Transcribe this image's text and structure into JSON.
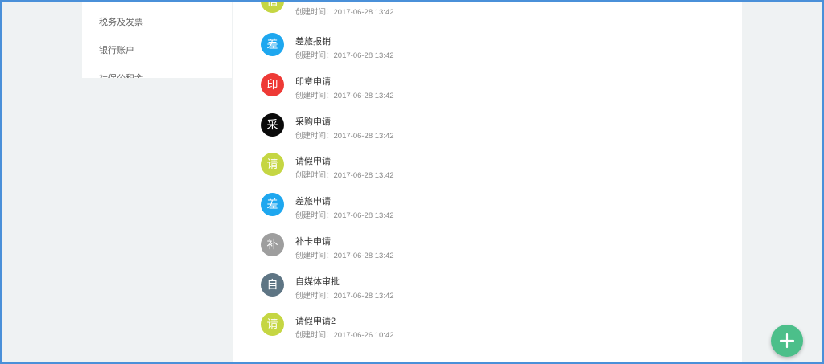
{
  "sidebar": {
    "items": [
      {
        "label": "税务及发票"
      },
      {
        "label": "银行账户"
      },
      {
        "label": "社保公积金"
      }
    ]
  },
  "list": {
    "time_prefix": "创建时间：",
    "items": [
      {
        "avatar": "借",
        "color": "#c5d643",
        "title": "",
        "time": "2017-06-28 13:42"
      },
      {
        "avatar": "差",
        "color": "#1ea7ef",
        "title": "差旅报销",
        "time": "2017-06-28 13:42"
      },
      {
        "avatar": "印",
        "color": "#ee3a36",
        "title": "印章申请",
        "time": "2017-06-28 13:42"
      },
      {
        "avatar": "采",
        "color": "#0a0a0a",
        "title": "采购申请",
        "time": "2017-06-28 13:42"
      },
      {
        "avatar": "请",
        "color": "#c5d643",
        "title": "请假申请",
        "time": "2017-06-28 13:42"
      },
      {
        "avatar": "差",
        "color": "#1ea7ef",
        "title": "差旅申请",
        "time": "2017-06-28 13:42"
      },
      {
        "avatar": "补",
        "color": "#9e9e9e",
        "title": "补卡申请",
        "time": "2017-06-28 13:42"
      },
      {
        "avatar": "自",
        "color": "#5e7584",
        "title": "自媒体审批",
        "time": "2017-06-28 13:42"
      },
      {
        "avatar": "请",
        "color": "#c5d643",
        "title": "请假申请2",
        "time": "2017-06-26 10:42"
      }
    ]
  },
  "fab": {
    "icon": "plus-icon",
    "color": "#4cbf8a"
  }
}
